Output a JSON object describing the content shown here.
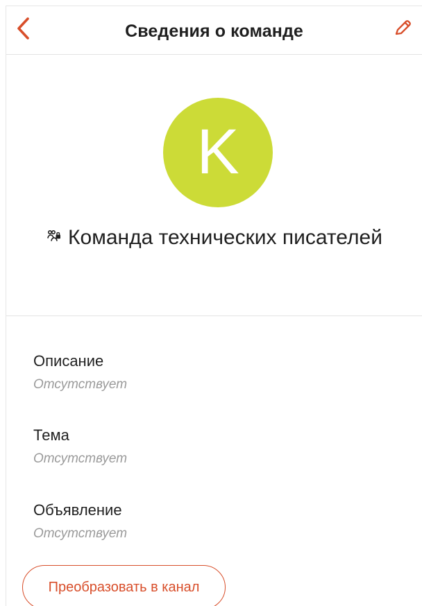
{
  "header": {
    "title": "Сведения о команде"
  },
  "icons": {
    "back": "chevron-left-icon",
    "edit": "pencil-icon",
    "team": "team-lock-icon"
  },
  "colors": {
    "accent": "#d84e2a",
    "avatar": "#ccdb37"
  },
  "profile": {
    "avatar_letter": "K",
    "team_name": "Команда технических писателей"
  },
  "details": {
    "description_label": "Описание",
    "description_value": "Отсутствует",
    "topic_label": "Тема",
    "topic_value": "Отсутствует",
    "announcement_label": "Объявление",
    "announcement_value": "Отсутствует"
  },
  "actions": {
    "convert_label": "Преобразовать в канал"
  }
}
